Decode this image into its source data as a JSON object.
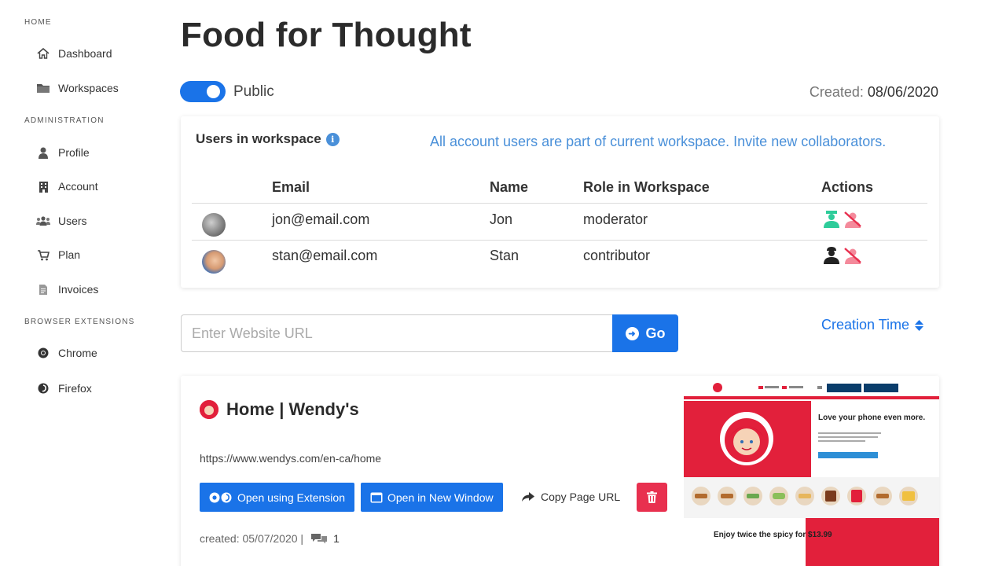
{
  "sidebar": {
    "sections": [
      {
        "label": "HOME"
      },
      {
        "label": "ADMINISTRATION"
      },
      {
        "label": "BROWSER EXTENSIONS"
      }
    ],
    "items": [
      {
        "label": "Dashboard",
        "icon": "home-icon"
      },
      {
        "label": "Workspaces",
        "icon": "folder-icon"
      },
      {
        "label": "Profile",
        "icon": "user-icon"
      },
      {
        "label": "Account",
        "icon": "building-icon"
      },
      {
        "label": "Users",
        "icon": "users-icon"
      },
      {
        "label": "Plan",
        "icon": "cart-icon"
      },
      {
        "label": "Invoices",
        "icon": "file-icon"
      },
      {
        "label": "Chrome",
        "icon": "chrome-icon"
      },
      {
        "label": "Firefox",
        "icon": "firefox-icon"
      }
    ]
  },
  "workspace": {
    "title": "Food for Thought",
    "visibility_label": "Public",
    "visibility_on": true,
    "created_label": "Created:",
    "created_date": "08/06/2020"
  },
  "users_panel": {
    "title": "Users in workspace",
    "info_glyph": "i",
    "invite_text": "All account users are part of current workspace. Invite new collaborators.",
    "columns": [
      "Email",
      "Name",
      "Role in Workspace",
      "Actions"
    ],
    "rows": [
      {
        "email": "jon@email.com",
        "name": "Jon",
        "role": "moderator",
        "role_icon_color": "#2ecc9a"
      },
      {
        "email": "stan@email.com",
        "name": "Stan",
        "role": "contributor",
        "role_icon_color": "#222222"
      }
    ]
  },
  "url_bar": {
    "placeholder": "Enter Website URL",
    "go_label": "Go",
    "sort_label": "Creation Time"
  },
  "pages": [
    {
      "title": "Home | Wendy's",
      "url": "https://www.wendys.com/en-ca/home",
      "open_extension_label": "Open using Extension",
      "open_window_label": "Open in New Window",
      "copy_label": "Copy Page URL",
      "created_text": "created: 05/07/2020 |",
      "comment_count": "1",
      "thumbnail": {
        "headline": "Love your phone even more.",
        "promo": "Enjoy twice the spicy for $13.99"
      }
    }
  ],
  "colors": {
    "accent": "#1a73e8",
    "link": "#4a90d9",
    "danger": "#e8304f",
    "brand_red": "#e2203b"
  }
}
